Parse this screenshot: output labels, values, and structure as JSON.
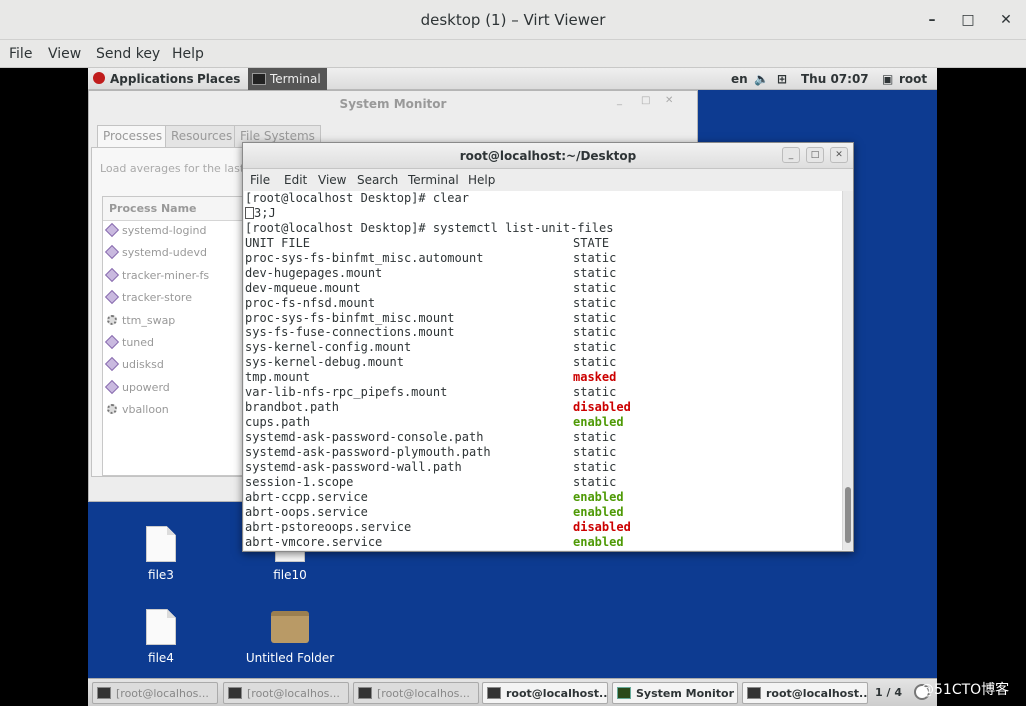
{
  "outer": {
    "title": "desktop (1) – Virt Viewer",
    "menu": [
      "File",
      "View",
      "Send key",
      "Help"
    ],
    "minimize_glyph": "–",
    "maximize_glyph": "□",
    "close_glyph": "✕"
  },
  "top_panel": {
    "applications": "Applications",
    "places": "Places",
    "terminal_task": "Terminal",
    "lang": "en",
    "volume_glyph": "🔈",
    "network_glyph": "⊞",
    "clock": "Thu 07:07",
    "user_glyph": "▣",
    "user": "root"
  },
  "sysmon": {
    "title": "System Monitor",
    "tabs": [
      "Processes",
      "Resources",
      "File Systems"
    ],
    "load_avg": "Load averages for the last",
    "process_header": "Process Name",
    "processes": [
      "systemd-logind",
      "systemd-udevd",
      "tracker-miner-fs",
      "tracker-store",
      "ttm_swap",
      "tuned",
      "udisksd",
      "upowerd",
      "vballoon"
    ]
  },
  "terminal": {
    "title": "root@localhost:~/Desktop",
    "menu": [
      "File",
      "Edit",
      "View",
      "Search",
      "Terminal",
      "Help"
    ],
    "prompt1": "[root@localhost Desktop]# clear",
    "escape_line": "3;J",
    "prompt2": "[root@localhost Desktop]# systemctl list-unit-files",
    "col_unit": "UNIT FILE",
    "col_state": "STATE",
    "units": [
      {
        "unit": "proc-sys-fs-binfmt_misc.automount",
        "state": "static"
      },
      {
        "unit": "dev-hugepages.mount",
        "state": "static"
      },
      {
        "unit": "dev-mqueue.mount",
        "state": "static"
      },
      {
        "unit": "proc-fs-nfsd.mount",
        "state": "static"
      },
      {
        "unit": "proc-sys-fs-binfmt_misc.mount",
        "state": "static"
      },
      {
        "unit": "sys-fs-fuse-connections.mount",
        "state": "static"
      },
      {
        "unit": "sys-kernel-config.mount",
        "state": "static"
      },
      {
        "unit": "sys-kernel-debug.mount",
        "state": "static"
      },
      {
        "unit": "tmp.mount",
        "state": "masked"
      },
      {
        "unit": "var-lib-nfs-rpc_pipefs.mount",
        "state": "static"
      },
      {
        "unit": "brandbot.path",
        "state": "disabled"
      },
      {
        "unit": "cups.path",
        "state": "enabled"
      },
      {
        "unit": "systemd-ask-password-console.path",
        "state": "static"
      },
      {
        "unit": "systemd-ask-password-plymouth.path",
        "state": "static"
      },
      {
        "unit": "systemd-ask-password-wall.path",
        "state": "static"
      },
      {
        "unit": "session-1.scope",
        "state": "static"
      },
      {
        "unit": "abrt-ccpp.service",
        "state": "enabled"
      },
      {
        "unit": "abrt-oops.service",
        "state": "enabled"
      },
      {
        "unit": "abrt-pstoreoops.service",
        "state": "disabled"
      },
      {
        "unit": "abrt-vmcore.service",
        "state": "enabled"
      }
    ]
  },
  "desktop": {
    "icons": [
      "file3",
      "file10",
      "file4",
      "Untitled Folder"
    ]
  },
  "taskbar": {
    "tasks": [
      "[root@localhos...",
      "[root@localhos...",
      "[root@localhos...",
      "root@localhost...",
      "System Monitor",
      "root@localhost..."
    ],
    "pager": "1 / 4"
  },
  "watermark": "@51CTO博客"
}
